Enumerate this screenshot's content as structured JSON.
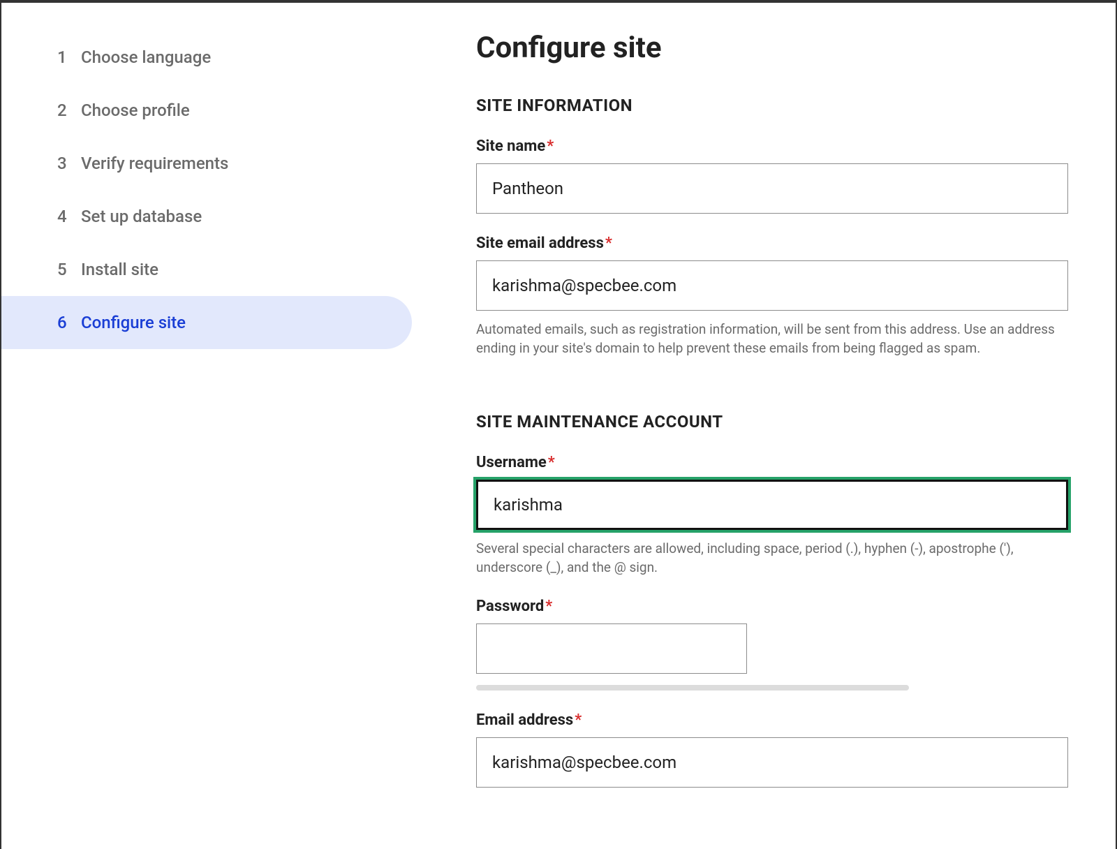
{
  "sidebar": {
    "steps": [
      {
        "num": "1",
        "label": "Choose language"
      },
      {
        "num": "2",
        "label": "Choose profile"
      },
      {
        "num": "3",
        "label": "Verify requirements"
      },
      {
        "num": "4",
        "label": "Set up database"
      },
      {
        "num": "5",
        "label": "Install site"
      },
      {
        "num": "6",
        "label": "Configure site"
      }
    ]
  },
  "main": {
    "title": "Configure site",
    "section_info": {
      "heading": "SITE INFORMATION",
      "site_name": {
        "label": "Site name",
        "value": "Pantheon"
      },
      "site_email": {
        "label": "Site email address",
        "value": "karishma@specbee.com",
        "help": "Automated emails, such as registration information, will be sent from this address. Use an address ending in your site's domain to help prevent these emails from being flagged as spam."
      }
    },
    "section_account": {
      "heading": "SITE MAINTENANCE ACCOUNT",
      "username": {
        "label": "Username",
        "value": "karishma",
        "help": "Several special characters are allowed, including space, period (.), hyphen (-), apostrophe ('), underscore (_), and the @ sign."
      },
      "password": {
        "label": "Password",
        "value": ""
      },
      "email": {
        "label": "Email address",
        "value": "karishma@specbee.com"
      }
    },
    "required_marker": "*"
  }
}
